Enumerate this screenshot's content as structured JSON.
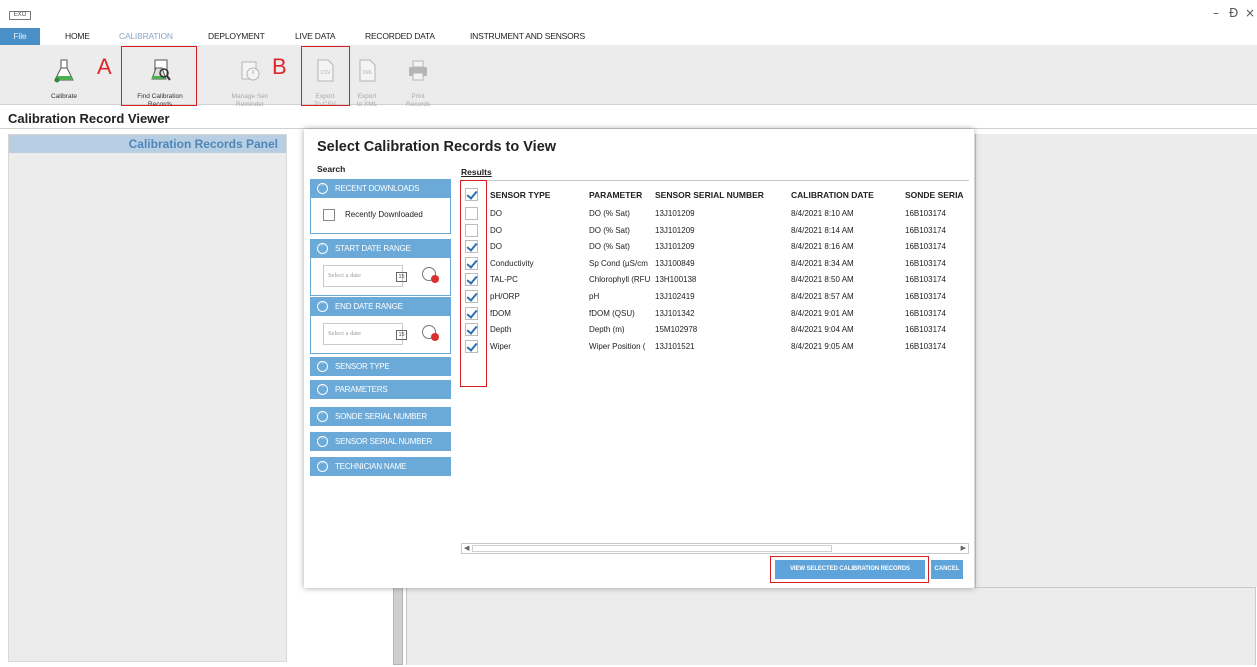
{
  "app": {
    "logo_text": "EXO"
  },
  "window_controls": {
    "minimize": "–",
    "restore": "Ɖ",
    "close": "×"
  },
  "menu": {
    "tabs": [
      "File",
      "HOME",
      "CALIBRATION",
      "DEPLOYMENT",
      "LIVE DATA",
      "RECORDED DATA",
      "INSTRUMENT AND SENSORS"
    ],
    "active_tab": "CALIBRATION"
  },
  "ribbon": {
    "buttons": [
      {
        "label": "Calibrate",
        "icon": "flask-icon",
        "enabled": true
      },
      {
        "label": "Find Calibration\nRecords",
        "icon": "find-records-icon",
        "enabled": true
      },
      {
        "label": "Manage Sen\nReminder",
        "icon": "reminder-icon",
        "enabled": false
      },
      {
        "label": "Export\nTo CSV",
        "icon": "csv-icon",
        "enabled": false
      },
      {
        "label": "Export\nto XML",
        "icon": "xml-icon",
        "enabled": false
      },
      {
        "label": "Print\nRecords",
        "icon": "printer-icon",
        "enabled": false
      }
    ]
  },
  "annotations": {
    "a": "A",
    "b": "B",
    "highlight_color": "#d42020"
  },
  "viewer": {
    "title": "Calibration Record Viewer",
    "panel_title": "Calibration Records Panel"
  },
  "dialog": {
    "title": "Select Calibration Records to View",
    "search_label": "Search",
    "results_label": "Results",
    "search_sections": [
      "RECENT DOWNLOADS",
      "START DATE RANGE",
      "END DATE RANGE",
      "SENSOR TYPE",
      "PARAMETERS",
      "SONDE SERIAL NUMBER",
      "SENSOR SERIAL NUMBER",
      "TECHNICIAN NAME"
    ],
    "recently_downloaded_label": "Recently Downloaded",
    "date_placeholder": "Select a date",
    "calendar_glyph": "15",
    "columns": [
      "SENSOR TYPE",
      "PARAMETER",
      "SENSOR SERIAL NUMBER",
      "CALIBRATION DATE",
      "SONDE SERIA"
    ],
    "header_checked": true,
    "rows": [
      {
        "checked": false,
        "sensor_type": "DO",
        "parameter": "DO (% Sat)",
        "sensor_serial": "13J101209",
        "calibration_date": "8/4/2021 8:10 AM",
        "sonde_serial": "16B103174"
      },
      {
        "checked": false,
        "sensor_type": "DO",
        "parameter": "DO (% Sat)",
        "sensor_serial": "13J101209",
        "calibration_date": "8/4/2021 8:14 AM",
        "sonde_serial": "16B103174"
      },
      {
        "checked": true,
        "sensor_type": "DO",
        "parameter": "DO (% Sat)",
        "sensor_serial": "13J101209",
        "calibration_date": "8/4/2021 8:16 AM",
        "sonde_serial": "16B103174"
      },
      {
        "checked": true,
        "sensor_type": "Conductivity",
        "parameter": "Sp Cond (µS/cm",
        "sensor_serial": "13J100849",
        "calibration_date": "8/4/2021 8:34 AM",
        "sonde_serial": "16B103174"
      },
      {
        "checked": true,
        "sensor_type": "TAL-PC",
        "parameter": "Chlorophyll (RFU",
        "sensor_serial": "13H100138",
        "calibration_date": "8/4/2021 8:50 AM",
        "sonde_serial": "16B103174"
      },
      {
        "checked": true,
        "sensor_type": "pH/ORP",
        "parameter": "pH",
        "sensor_serial": "13J102419",
        "calibration_date": "8/4/2021 8:57 AM",
        "sonde_serial": "16B103174"
      },
      {
        "checked": true,
        "sensor_type": "fDOM",
        "parameter": "fDOM (QSU)",
        "sensor_serial": "13J101342",
        "calibration_date": "8/4/2021 9:01 AM",
        "sonde_serial": "16B103174"
      },
      {
        "checked": true,
        "sensor_type": "Depth",
        "parameter": "Depth (m)",
        "sensor_serial": "15M102978",
        "calibration_date": "8/4/2021 9:04 AM",
        "sonde_serial": "16B103174"
      },
      {
        "checked": true,
        "sensor_type": "Wiper",
        "parameter": "Wiper Position (",
        "sensor_serial": "13J101521",
        "calibration_date": "8/4/2021 9:05 AM",
        "sonde_serial": "16B103174"
      }
    ],
    "view_button": "VIEW SELECTED CALIBRATION RECORDS",
    "cancel_button": "CANCEL"
  },
  "colors": {
    "accent": "#5ea3d9",
    "file_tab": "#4a90c8",
    "panel_header_text": "#4e86b8"
  }
}
